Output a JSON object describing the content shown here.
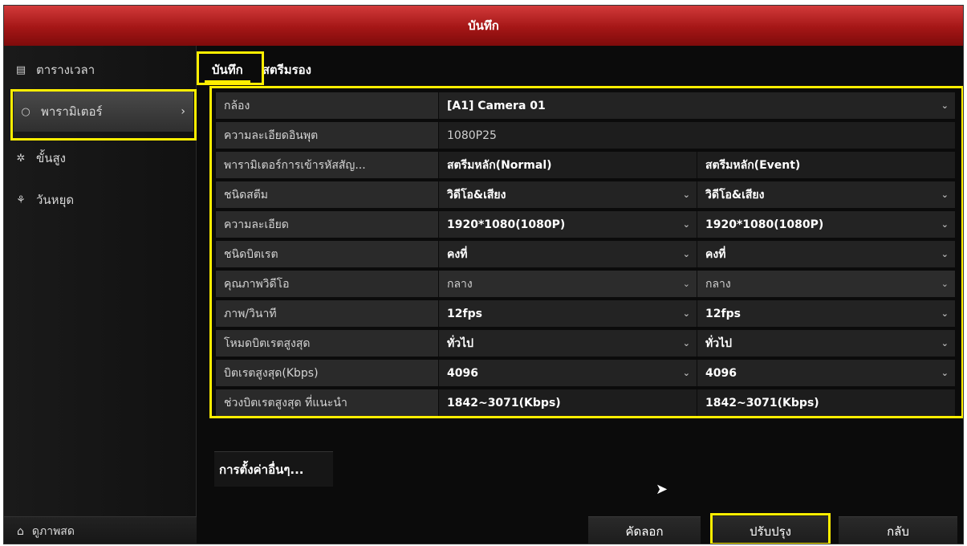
{
  "window": {
    "title": "บันทึก"
  },
  "sidebar": {
    "items": [
      {
        "label": "ตารางเวลา",
        "icon": "calendar-icon"
      },
      {
        "label": "พารามิเตอร์",
        "icon": "gear-icon",
        "selected": true
      },
      {
        "label": "ขั้นสูง",
        "icon": "advanced-icon"
      },
      {
        "label": "วันหยุด",
        "icon": "holiday-icon"
      }
    ],
    "live_view": {
      "label": "ดูภาพสด",
      "icon": "home-icon"
    }
  },
  "tabs": [
    {
      "label": "บันทึก",
      "active": true
    },
    {
      "label": "สตรีมรอง",
      "active": false
    }
  ],
  "params": {
    "camera": {
      "label": "กล้อง",
      "value": "[A1] Camera 01"
    },
    "input_resolution": {
      "label": "ความละเอียดอินพุต",
      "value": "1080P25"
    },
    "encode_params": {
      "label": "พารามิเตอร์การเข้ารหัสสัญ...",
      "a": "สตรีมหลัก(Normal)",
      "b": "สตรีมหลัก(Event)"
    },
    "stream_type": {
      "label": "ชนิดสตีม",
      "a": "วิดีโอ&เสียง",
      "b": "วิดีโอ&เสียง"
    },
    "resolution": {
      "label": "ความละเอียด",
      "a": "1920*1080(1080P)",
      "b": "1920*1080(1080P)"
    },
    "bitrate_type": {
      "label": "ชนิดบิตเรต",
      "a": "คงที่",
      "b": "คงที่"
    },
    "video_quality": {
      "label": "คุณภาพวิดีโอ",
      "a": "กลาง",
      "b": "กลาง"
    },
    "frame_rate": {
      "label": "ภาพ/วินาที",
      "a": "12fps",
      "b": "12fps"
    },
    "max_bitrate_mode": {
      "label": "โหมดบิตเรตสูงสุด",
      "a": "ทั่วไป",
      "b": "ทั่วไป"
    },
    "max_bitrate": {
      "label": "บิตเรตสูงสุด(Kbps)",
      "a": "4096",
      "b": "4096"
    },
    "recommended_range": {
      "label": "ช่วงบิตเรตสูงสุด ที่แนะนำ",
      "a": "1842~3071(Kbps)",
      "b": "1842~3071(Kbps)"
    }
  },
  "more_settings": {
    "label": "การตั้งค่าอื่นๆ..."
  },
  "buttons": {
    "copy": "คัดลอก",
    "apply": "ปรับปรุง",
    "back": "กลับ"
  },
  "colors": {
    "titlebar": "#b01e1e",
    "highlight": "#ffee00"
  }
}
